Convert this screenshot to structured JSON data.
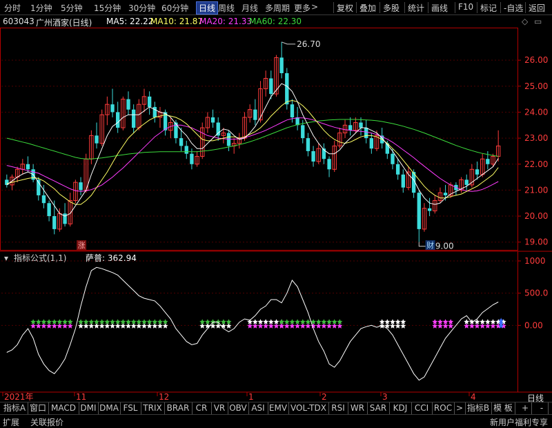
{
  "toolbar": {
    "items": [
      "分时",
      "1分钟",
      "5分钟",
      "15分钟",
      "30分钟",
      "60分钟",
      "日线",
      "周线",
      "月线",
      "多周期",
      "更多"
    ],
    "more_arrow": ">",
    "active": "日线",
    "right_items": [
      "复权",
      "叠加",
      "多股",
      "统计",
      "画线",
      "F10",
      "标记",
      "-自选",
      "返回"
    ]
  },
  "info": {
    "code": "603043",
    "name": "广州酒家(日线)",
    "ma5": "MA5: 22.22",
    "ma10": "MA10: 21.87",
    "ma20": "MA20: 21.33",
    "ma60": "MA60: 22.30"
  },
  "colors": {
    "up": "#ff3c3c",
    "down": "#3cdcdc",
    "ma5": "#ffffff",
    "ma10": "#ffff64",
    "ma20": "#ff3cff",
    "ma60": "#3cdc3c",
    "axis": "#b40000",
    "grid": "#500000"
  },
  "chart_data": {
    "type": "candlestick",
    "price_axis": {
      "ticks": [
        19.0,
        20.0,
        21.0,
        22.0,
        23.0,
        24.0,
        25.0,
        26.0
      ],
      "labels": [
        "19.00",
        "20.00",
        "21.00",
        "22.00",
        "23.00",
        "24.00",
        "25.00",
        "26.00"
      ],
      "range": [
        18.7,
        27.2
      ]
    },
    "annotations": {
      "high": "26.70",
      "low": "19.00",
      "high_value": 26.7,
      "low_value": 19.0
    },
    "markers": [
      "涨",
      "财"
    ],
    "time_axis": [
      "2021年",
      "11",
      "12",
      "1",
      "2",
      "3",
      "4"
    ],
    "indicator": {
      "title": "指标公式(1,1)",
      "series_label": "萨普: 362.94",
      "ticks": [
        0,
        500,
        1000
      ],
      "labels": [
        "0.00",
        "500.0",
        "1000"
      ],
      "range": [
        -950,
        1150
      ]
    },
    "candles": [
      [
        21.4,
        21.6,
        21.1,
        21.2
      ],
      [
        21.2,
        21.6,
        21.0,
        21.5
      ],
      [
        21.5,
        21.9,
        21.3,
        21.8
      ],
      [
        21.8,
        22.2,
        21.6,
        22.0
      ],
      [
        22.0,
        22.3,
        21.7,
        21.8
      ],
      [
        21.8,
        22.0,
        21.3,
        21.4
      ],
      [
        21.4,
        21.5,
        20.6,
        20.8
      ],
      [
        20.8,
        21.2,
        20.3,
        20.5
      ],
      [
        20.5,
        20.6,
        19.8,
        20.0
      ],
      [
        20.0,
        20.6,
        19.3,
        19.5
      ],
      [
        19.5,
        20.3,
        19.4,
        20.1
      ],
      [
        20.1,
        20.5,
        19.6,
        19.7
      ],
      [
        19.7,
        20.9,
        19.6,
        20.6
      ],
      [
        20.6,
        21.4,
        20.5,
        21.3
      ],
      [
        21.3,
        21.5,
        20.8,
        21.0
      ],
      [
        21.0,
        22.4,
        20.9,
        22.2
      ],
      [
        22.2,
        23.3,
        22.0,
        23.1
      ],
      [
        23.1,
        23.6,
        22.6,
        22.8
      ],
      [
        22.8,
        24.1,
        22.7,
        23.9
      ],
      [
        23.9,
        24.6,
        23.5,
        24.3
      ],
      [
        24.3,
        24.9,
        23.8,
        24.0
      ],
      [
        24.0,
        24.4,
        23.2,
        23.4
      ],
      [
        23.4,
        24.6,
        23.3,
        24.5
      ],
      [
        24.5,
        24.8,
        23.9,
        24.1
      ],
      [
        24.1,
        24.3,
        23.2,
        23.4
      ],
      [
        23.4,
        24.5,
        23.3,
        24.3
      ],
      [
        24.3,
        24.9,
        24.0,
        24.6
      ],
      [
        24.6,
        24.8,
        23.9,
        24.2
      ],
      [
        24.2,
        24.4,
        23.6,
        23.8
      ],
      [
        23.8,
        24.2,
        23.4,
        24.0
      ],
      [
        24.0,
        24.1,
        23.1,
        23.3
      ],
      [
        23.3,
        23.8,
        23.0,
        23.6
      ],
      [
        23.6,
        23.7,
        22.8,
        23.0
      ],
      [
        23.0,
        23.4,
        22.5,
        22.7
      ],
      [
        22.7,
        22.9,
        22.2,
        22.4
      ],
      [
        22.4,
        22.6,
        21.8,
        22.0
      ],
      [
        22.0,
        22.5,
        21.9,
        22.3
      ],
      [
        22.3,
        23.6,
        22.2,
        23.4
      ],
      [
        23.4,
        24.0,
        23.2,
        23.8
      ],
      [
        23.8,
        24.1,
        23.4,
        23.6
      ],
      [
        23.6,
        23.8,
        22.9,
        23.1
      ],
      [
        23.1,
        23.4,
        22.8,
        23.2
      ],
      [
        23.2,
        23.3,
        22.5,
        22.7
      ],
      [
        22.7,
        23.0,
        22.4,
        22.8
      ],
      [
        22.8,
        23.2,
        22.6,
        23.0
      ],
      [
        23.0,
        24.0,
        22.9,
        23.8
      ],
      [
        23.8,
        24.3,
        23.6,
        24.1
      ],
      [
        24.1,
        24.5,
        23.5,
        23.7
      ],
      [
        23.7,
        25.2,
        23.6,
        24.9
      ],
      [
        24.9,
        25.6,
        24.6,
        25.3
      ],
      [
        25.3,
        25.6,
        24.5,
        24.7
      ],
      [
        24.7,
        26.2,
        24.6,
        26.1
      ],
      [
        26.1,
        26.7,
        25.3,
        25.5
      ],
      [
        25.5,
        25.7,
        24.1,
        24.3
      ],
      [
        24.3,
        24.5,
        23.6,
        23.8
      ],
      [
        23.8,
        24.2,
        23.3,
        23.5
      ],
      [
        23.5,
        23.7,
        22.8,
        23.0
      ],
      [
        23.0,
        23.2,
        22.3,
        22.5
      ],
      [
        22.5,
        22.7,
        21.9,
        22.1
      ],
      [
        22.1,
        22.8,
        22.0,
        22.6
      ],
      [
        22.6,
        22.8,
        22.0,
        22.2
      ],
      [
        22.2,
        22.3,
        21.5,
        21.8
      ],
      [
        21.8,
        22.9,
        21.7,
        22.7
      ],
      [
        22.7,
        23.4,
        22.6,
        23.2
      ],
      [
        23.2,
        23.7,
        23.0,
        23.5
      ],
      [
        23.5,
        23.8,
        23.1,
        23.3
      ],
      [
        23.3,
        23.8,
        23.2,
        23.6
      ],
      [
        23.6,
        23.8,
        23.1,
        23.4
      ],
      [
        23.4,
        23.7,
        22.8,
        23.0
      ],
      [
        23.0,
        23.2,
        22.4,
        22.6
      ],
      [
        22.6,
        23.3,
        22.5,
        23.1
      ],
      [
        23.1,
        23.4,
        22.6,
        22.8
      ],
      [
        22.8,
        22.9,
        22.2,
        22.4
      ],
      [
        22.4,
        22.6,
        21.8,
        22.0
      ],
      [
        22.0,
        22.2,
        21.4,
        21.6
      ],
      [
        21.6,
        21.8,
        20.9,
        21.1
      ],
      [
        21.1,
        21.9,
        21.0,
        21.7
      ],
      [
        21.7,
        21.8,
        20.7,
        20.9
      ],
      [
        20.9,
        21.0,
        19.0,
        19.5
      ],
      [
        19.5,
        20.5,
        19.4,
        20.3
      ],
      [
        20.3,
        20.7,
        20.0,
        20.2
      ],
      [
        20.2,
        20.8,
        20.1,
        20.6
      ],
      [
        20.6,
        21.1,
        20.5,
        20.9
      ],
      [
        20.9,
        21.2,
        20.6,
        20.8
      ],
      [
        20.8,
        21.3,
        20.7,
        21.2
      ],
      [
        21.2,
        21.3,
        20.8,
        21.0
      ],
      [
        21.0,
        21.5,
        20.9,
        21.4
      ],
      [
        21.4,
        21.6,
        21.0,
        21.2
      ],
      [
        21.2,
        22.0,
        21.1,
        21.8
      ],
      [
        21.8,
        22.1,
        21.4,
        21.6
      ],
      [
        21.6,
        22.4,
        21.5,
        22.2
      ],
      [
        22.2,
        22.5,
        21.8,
        22.0
      ],
      [
        22.0,
        22.4,
        21.9,
        22.3
      ],
      [
        22.3,
        23.3,
        22.1,
        22.7
      ]
    ],
    "ma5": [
      21.2,
      21.35,
      21.5,
      21.62,
      21.7,
      21.6,
      21.3,
      21.0,
      20.7,
      20.4,
      20.1,
      20.0,
      20.1,
      20.4,
      20.7,
      21.0,
      21.6,
      22.1,
      22.6,
      23.1,
      23.45,
      23.6,
      23.8,
      23.9,
      23.9,
      23.9,
      24.05,
      24.2,
      24.1,
      24.0,
      23.95,
      23.8,
      23.55,
      23.3,
      23.1,
      22.8,
      22.6,
      22.6,
      22.8,
      23.0,
      23.2,
      23.35,
      23.3,
      23.1,
      22.95,
      23.0,
      23.2,
      23.45,
      23.8,
      24.2,
      24.6,
      24.85,
      25.1,
      25.0,
      24.8,
      24.4,
      23.9,
      23.5,
      23.1,
      22.8,
      22.55,
      22.4,
      22.4,
      22.55,
      22.8,
      23.0,
      23.2,
      23.4,
      23.4,
      23.3,
      23.2,
      23.0,
      22.75,
      22.5,
      22.2,
      21.9,
      21.6,
      21.4,
      21.0,
      20.7,
      20.5,
      20.45,
      20.5,
      20.7,
      20.85,
      20.95,
      21.05,
      21.15,
      21.3,
      21.45,
      21.6,
      21.75,
      21.9,
      22.22
    ],
    "ma10": [
      21.25,
      21.3,
      21.35,
      21.4,
      21.45,
      21.48,
      21.45,
      21.35,
      21.2,
      21.05,
      20.85,
      20.7,
      20.55,
      20.45,
      20.45,
      20.6,
      20.8,
      21.1,
      21.4,
      21.7,
      22.05,
      22.4,
      22.7,
      23.0,
      23.2,
      23.4,
      23.55,
      23.7,
      23.8,
      23.85,
      23.9,
      23.85,
      23.8,
      23.7,
      23.55,
      23.35,
      23.15,
      22.95,
      22.9,
      22.9,
      22.95,
      23.0,
      23.05,
      23.05,
      23.0,
      23.05,
      23.15,
      23.25,
      23.4,
      23.6,
      23.85,
      24.05,
      24.25,
      24.4,
      24.45,
      24.4,
      24.25,
      24.05,
      23.8,
      23.55,
      23.3,
      23.1,
      22.95,
      22.85,
      22.8,
      22.85,
      22.95,
      23.05,
      23.1,
      23.1,
      23.05,
      22.95,
      22.8,
      22.6,
      22.4,
      22.15,
      21.9,
      21.65,
      21.4,
      21.15,
      20.95,
      20.8,
      20.7,
      20.7,
      20.75,
      20.8,
      20.85,
      20.95,
      21.05,
      21.15,
      21.3,
      21.45,
      21.6,
      21.87
    ],
    "ma20": [
      21.95,
      21.9,
      21.85,
      21.8,
      21.75,
      21.7,
      21.65,
      21.55,
      21.45,
      21.35,
      21.25,
      21.15,
      21.05,
      20.98,
      20.95,
      20.97,
      21.02,
      21.1,
      21.2,
      21.35,
      21.5,
      21.68,
      21.85,
      22.05,
      22.25,
      22.45,
      22.65,
      22.85,
      23.05,
      23.2,
      23.35,
      23.45,
      23.5,
      23.5,
      23.45,
      23.4,
      23.3,
      23.2,
      23.1,
      23.05,
      23.0,
      22.98,
      22.96,
      22.96,
      22.98,
      23.02,
      23.08,
      23.15,
      23.22,
      23.3,
      23.4,
      23.5,
      23.6,
      23.7,
      23.75,
      23.78,
      23.78,
      23.75,
      23.7,
      23.62,
      23.55,
      23.48,
      23.42,
      23.37,
      23.33,
      23.3,
      23.28,
      23.26,
      23.24,
      23.2,
      23.14,
      23.06,
      22.96,
      22.84,
      22.7,
      22.55,
      22.4,
      22.25,
      22.08,
      21.92,
      21.76,
      21.6,
      21.45,
      21.32,
      21.2,
      21.1,
      21.02,
      20.97,
      20.95,
      20.97,
      21.03,
      21.12,
      21.22,
      21.33
    ],
    "ma60": [
      23.0,
      22.95,
      22.9,
      22.85,
      22.8,
      22.74,
      22.68,
      22.62,
      22.56,
      22.5,
      22.44,
      22.38,
      22.32,
      22.26,
      22.22,
      22.2,
      22.2,
      22.22,
      22.24,
      22.27,
      22.3,
      22.33,
      22.36,
      22.39,
      22.41,
      22.43,
      22.45,
      22.46,
      22.47,
      22.48,
      22.48,
      22.48,
      22.48,
      22.48,
      22.48,
      22.48,
      22.48,
      22.5,
      22.52,
      22.55,
      22.58,
      22.62,
      22.66,
      22.7,
      22.75,
      22.8,
      22.86,
      22.93,
      23.0,
      23.08,
      23.16,
      23.24,
      23.32,
      23.4,
      23.46,
      23.52,
      23.56,
      23.6,
      23.63,
      23.66,
      23.68,
      23.7,
      23.71,
      23.72,
      23.72,
      23.72,
      23.72,
      23.71,
      23.7,
      23.69,
      23.67,
      23.64,
      23.6,
      23.56,
      23.51,
      23.46,
      23.4,
      23.34,
      23.27,
      23.2,
      23.12,
      23.04,
      22.96,
      22.88,
      22.8,
      22.72,
      22.65,
      22.58,
      22.52,
      22.46,
      22.41,
      22.37,
      22.33,
      22.3
    ],
    "sar_line": [
      -420,
      -380,
      -300,
      -150,
      -50,
      -200,
      -450,
      -600,
      -700,
      -750,
      -650,
      -520,
      -300,
      -50,
      300,
      600,
      850,
      900,
      880,
      850,
      820,
      780,
      700,
      620,
      540,
      460,
      420,
      400,
      380,
      300,
      200,
      100,
      -50,
      -150,
      -250,
      -300,
      -280,
      -150,
      -50,
      50,
      50,
      -50,
      -100,
      -50,
      50,
      100,
      80,
      150,
      250,
      300,
      400,
      400,
      350,
      500,
      700,
      600,
      400,
      200,
      -50,
      -250,
      -400,
      -600,
      -650,
      -550,
      -400,
      -250,
      -150,
      -50,
      -20,
      0,
      -30,
      0,
      -50,
      -150,
      -300,
      -450,
      -600,
      -750,
      -850,
      -800,
      -650,
      -500,
      -350,
      -200,
      -100,
      0,
      100,
      150,
      50,
      100,
      200,
      260,
      320,
      363
    ],
    "stars": [
      {
        "s": 5,
        "e": 12,
        "c": "#40c040",
        "c2": "#ff40ff"
      },
      {
        "s": 14,
        "e": 30,
        "c": "#40c040",
        "c2": "#ffffff"
      },
      {
        "s": 37,
        "e": 42,
        "c": "#40c040",
        "c2": "#ffffff"
      },
      {
        "s": 46,
        "e": 52,
        "c": "#ffffff",
        "c2": "#ff40ff"
      },
      {
        "s": 52,
        "e": 63,
        "c": "#40c040",
        "c2": "#ff40ff"
      },
      {
        "s": 71,
        "e": 75,
        "c": "#ffffff",
        "c2": "#ffffff"
      },
      {
        "s": 81,
        "e": 84,
        "c": "#ff40ff",
        "c2": "#ff40ff"
      },
      {
        "s": 87,
        "e": 94,
        "c": "#ffffff",
        "c2": "#ff40ff"
      }
    ]
  },
  "tabs": [
    "指标A",
    "窗口",
    "MACD",
    "DMI",
    "DMA",
    "FSL",
    "TRIX",
    "BRAR",
    "CR",
    "VR",
    "OBV",
    "ASI",
    "EMV",
    "VOL-TDX",
    "RSI",
    "WR",
    "SAR",
    "KDJ",
    "CCI",
    "ROC",
    ">",
    "指标B",
    "模 板",
    "+",
    "-",
    "日线"
  ],
  "status": {
    "expand": "扩展",
    "linked": "关联报价",
    "promo": "新用户福利专享"
  }
}
